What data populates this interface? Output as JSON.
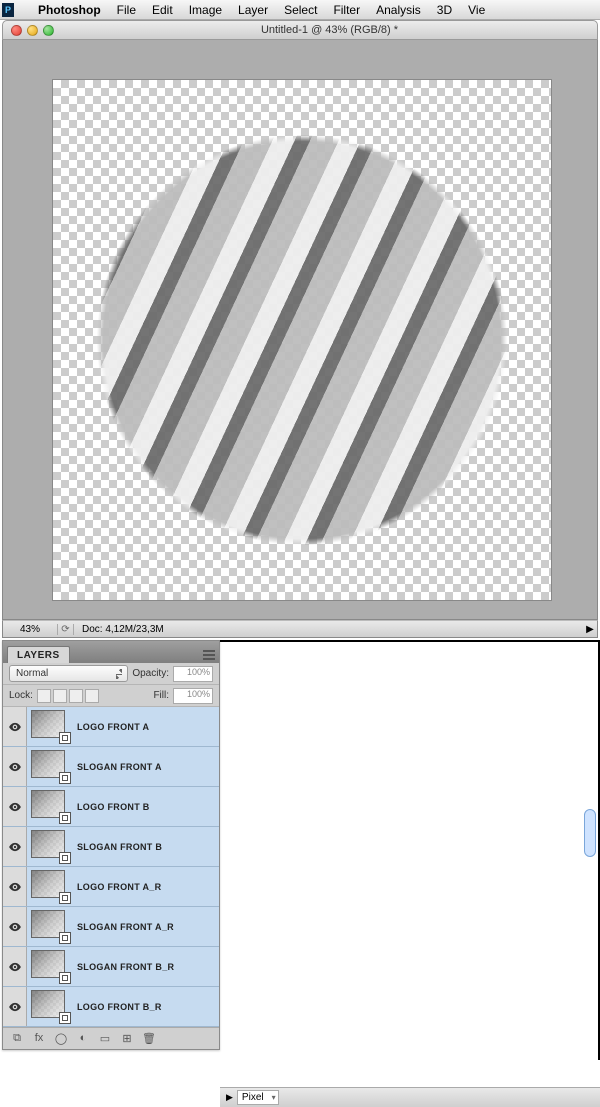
{
  "menubar": {
    "app": "Photoshop",
    "items": [
      "File",
      "Edit",
      "Image",
      "Layer",
      "Select",
      "Filter",
      "Analysis",
      "3D",
      "Vie"
    ]
  },
  "document": {
    "title": "Untitled-1 @ 43% (RGB/8) *",
    "zoom": "43%",
    "doc_info": "Doc: 4,12M/23,3M"
  },
  "layers_panel": {
    "tab": "LAYERS",
    "blend_mode": "Normal",
    "opacity_label": "Opacity:",
    "opacity_value": "100%",
    "lock_label": "Lock:",
    "fill_label": "Fill:",
    "fill_value": "100%",
    "layers": [
      {
        "name": "LOGO FRONT A"
      },
      {
        "name": "SLOGAN FRONT A"
      },
      {
        "name": "LOGO FRONT B"
      },
      {
        "name": "SLOGAN FRONT B"
      },
      {
        "name": "LOGO FRONT A_R"
      },
      {
        "name": "SLOGAN FRONT A_R"
      },
      {
        "name": "SLOGAN FRONT B_R"
      },
      {
        "name": "LOGO FRONT B_R"
      }
    ]
  },
  "bottom": {
    "unit": "Pixel"
  },
  "icons": {
    "link": "⧉",
    "fx": "fx",
    "mask": "◯",
    "adjust": "◐",
    "group": "▭",
    "new": "⊞",
    "trash": "🗑"
  }
}
